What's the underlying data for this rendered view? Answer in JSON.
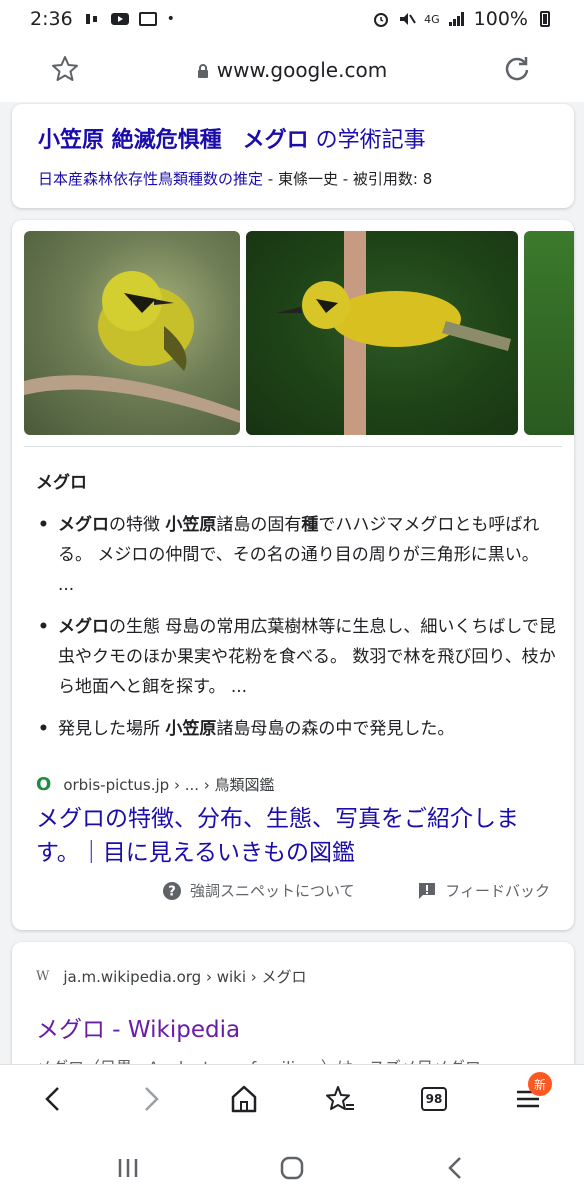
{
  "status": {
    "time": "2:36",
    "signal": "4G",
    "battery": "100%"
  },
  "browser": {
    "url": "www.google.com"
  },
  "scholar_card": {
    "title_parts": [
      "小笠原 絶滅危惧種",
      "メグロ",
      "の学術記事"
    ],
    "paper_link": "日本産森林依存性鳥類種数の推定",
    "paper_meta": " - 東條一史 - 被引用数: 8"
  },
  "featured_snippet": {
    "heading": "メグロ",
    "bullets": [
      {
        "bold": "メグロ",
        "text": "の特徴 ",
        "bold2": "小笠原",
        "text2": "諸島の固有",
        "bold3": "種",
        "text3": "でハハジマメグロとも呼ばれる。 メジロの仲間で、その名の通り目の周りが三角形に黒い。 ..."
      },
      {
        "bold": "メグロ",
        "text": "の生態 母島の常用広葉樹林等に生息し、細いくちばしで昆虫やクモのほか果実や花粉を食べる。 数羽で林を飛び回り、枝から地面へと餌を探す。 ..."
      },
      {
        "text": "発見した場所 ",
        "bold": "小笠原",
        "text2": "諸島母島の森の中で発見した。"
      }
    ],
    "source_favicon": "O",
    "source": "orbis-pictus.jp › ... › 鳥類図鑑",
    "link": "メグロの特徴、分布、生態、写真をご紹介します。｜目に見えるいきもの図鑑",
    "about": "強調スニペットについて",
    "feedback": "フィードバック"
  },
  "wiki_result": {
    "favicon": "W",
    "source": "ja.m.wikipedia.org › wiki › メグロ",
    "title": "メグロ - Wikipedia",
    "truncated_text": "メグロ（目黒、Apalopteron familiare）は、スズメ目メグロ"
  },
  "toolbar": {
    "tabs_count": "98",
    "new_badge": "新"
  },
  "colors": {
    "link": "#1a0dab",
    "visited": "#681da8",
    "green": "#1e8e3e"
  }
}
